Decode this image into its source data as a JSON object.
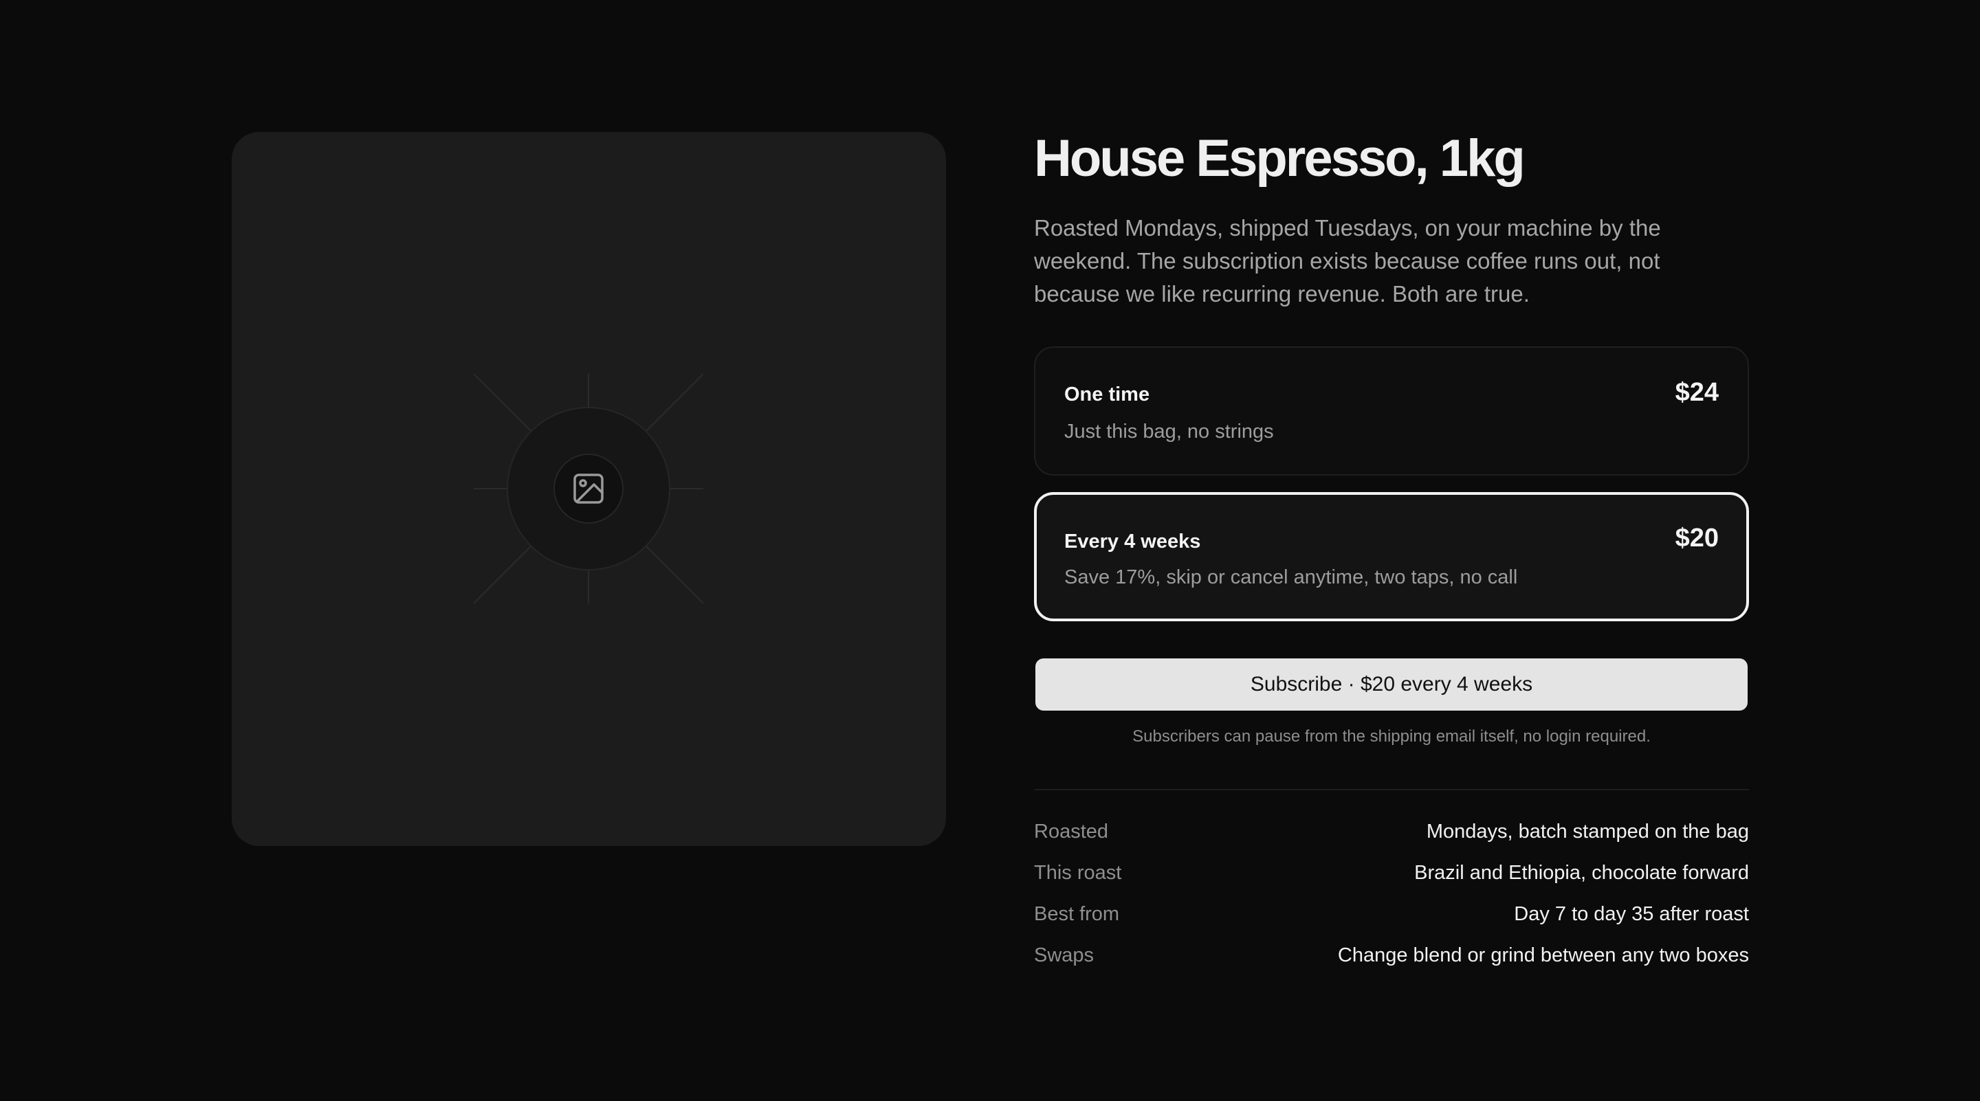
{
  "product": {
    "title": "House Espresso, 1kg",
    "description": "Roasted Mondays, shipped Tuesdays, on your machine by the weekend. The subscription exists because coffee runs out, not because we like recurring revenue. Both are true.",
    "image_placeholder_icon": "image-icon"
  },
  "options": [
    {
      "name": "One time",
      "subtitle": "Just this bag, no strings",
      "price": "$24",
      "selected": false
    },
    {
      "name": "Every 4 weeks",
      "subtitle": "Save 17%, skip or cancel anytime, two taps, no call",
      "price": "$20",
      "selected": true
    }
  ],
  "cta": {
    "label": "Subscribe · $20 every 4 weeks",
    "note": "Subscribers can pause from the shipping email itself, no login required."
  },
  "specs": [
    {
      "label": "Roasted",
      "value": "Mondays, batch stamped on the bag"
    },
    {
      "label": "This roast",
      "value": "Brazil and Ethiopia, chocolate forward"
    },
    {
      "label": "Best from",
      "value": "Day 7 to day 35 after roast"
    },
    {
      "label": "Swaps",
      "value": "Change blend or grind between any two boxes"
    }
  ],
  "colors": {
    "background": "#0b0b0b",
    "card": "#1c1c1c",
    "selected_border": "#f2f2f2",
    "cta_background": "#e4e4e4"
  }
}
